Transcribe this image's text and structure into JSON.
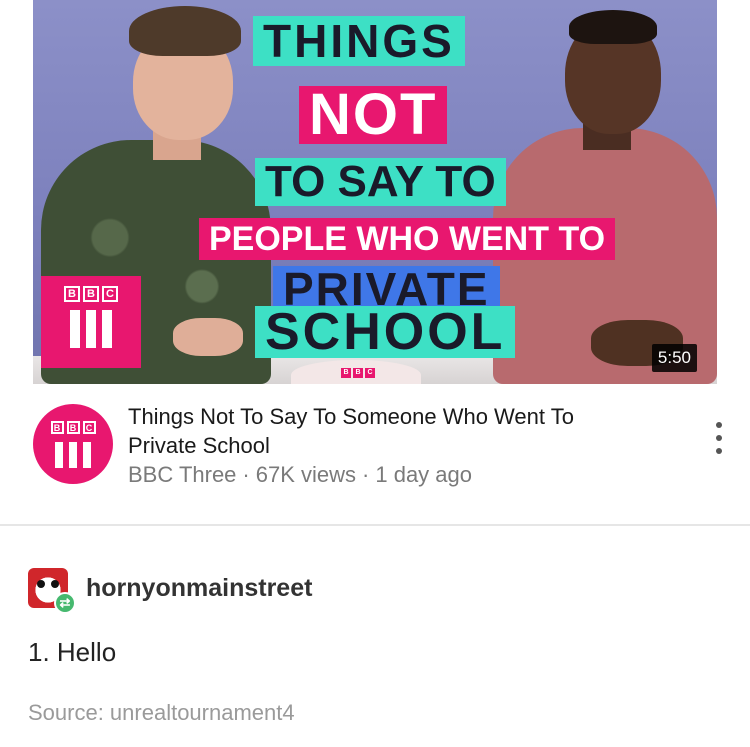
{
  "video": {
    "thumbnail": {
      "title_lines": [
        "THINGS",
        "NOT",
        "TO SAY TO",
        "PEOPLE WHO WENT TO",
        "PRIVATE",
        "SCHOOL"
      ],
      "logo_text": [
        "B",
        "B",
        "C"
      ],
      "mug_logo_text": [
        "B",
        "B",
        "C"
      ],
      "duration": "5:50"
    },
    "title": "Things Not To Say To Someone Who Went To Private School",
    "channel": "BBC Three",
    "views": "67K views",
    "age": "1 day ago",
    "separator": "·",
    "channel_logo_text": [
      "B",
      "B",
      "C"
    ],
    "more_icon": "more-vertical-icon"
  },
  "reblog": {
    "username": "hornyonmainstreet",
    "badge_icon": "reblog-icon",
    "badge_glyph": "⇄"
  },
  "post": {
    "text": "1. Hello",
    "source": "Source: unrealtournament4"
  },
  "colors": {
    "bbc_three_pink": "#e8176f",
    "title_teal": "#3de0c5",
    "title_blue": "#3f77e8",
    "reblog_green": "#46b96f"
  }
}
